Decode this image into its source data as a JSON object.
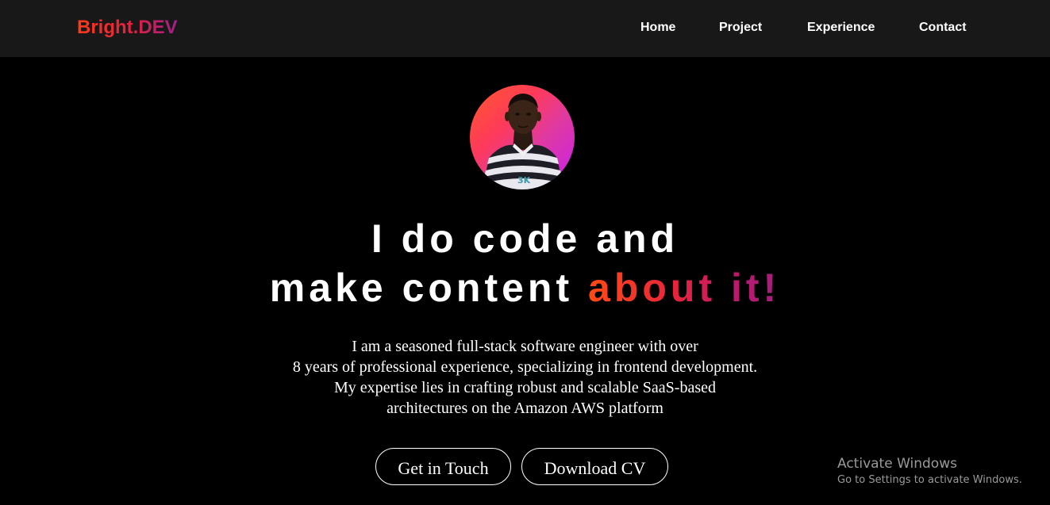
{
  "header": {
    "logo_text": "Bright.DEV",
    "logo_gradient": [
      "#ff3a1a",
      "#a0208a"
    ],
    "nav": [
      {
        "label": "Home"
      },
      {
        "label": "Project"
      },
      {
        "label": "Experience"
      },
      {
        "label": "Contact"
      }
    ]
  },
  "hero": {
    "avatar_icon": "profile-photo",
    "headline_line1": "I do code and",
    "headline_line2_prefix": "make content ",
    "headline_highlight": "about it!",
    "highlight_gradient": [
      "#ff4a14",
      "#a0207e"
    ],
    "bio_lines": [
      "I am a seasoned full-stack software engineer with over",
      "8 years of professional experience, specializing in frontend development.",
      "My expertise lies in crafting robust and scalable SaaS-based",
      "architectures on the Amazon AWS platform"
    ],
    "buttons": {
      "get_in_touch": "Get in Touch",
      "download_cv": "Download CV"
    }
  },
  "os_watermark": {
    "title": "Activate Windows",
    "subtitle": "Go to Settings to activate Windows."
  },
  "colors": {
    "page_background": "#000000",
    "navbar_background": "#181818",
    "text": "#ffffff"
  }
}
